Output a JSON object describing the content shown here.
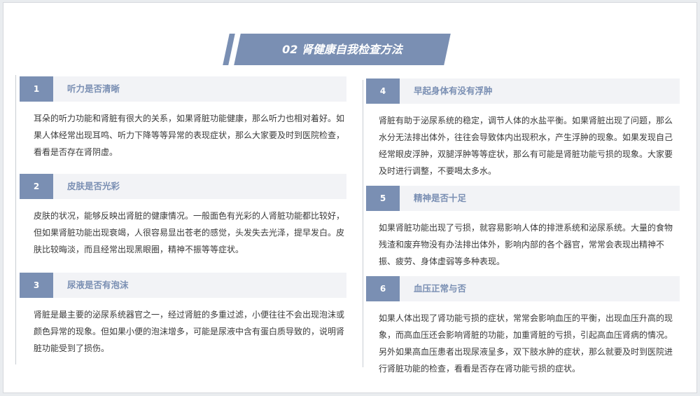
{
  "page": {
    "title": "02 肾健康自我检查方法"
  },
  "colors": {
    "accent": "#7a8fb3",
    "header_bg": "#f2f3f6",
    "body_text": "#3a3a3a"
  },
  "items": [
    {
      "number": "1",
      "title": "听力是否清晰",
      "body": "耳朵的听力功能和肾脏有很大的关系，如果肾脏功能健康，那么听力也相对着好。如果人体经常出现耳鸣、听力下降等等异常的表现症状，那么大家要及时到医院检查，看看是否存在肾阴虚。"
    },
    {
      "number": "2",
      "title": "皮肤是否光彩",
      "body": "皮肤的状况，能够反映出肾脏的健康情况。一般面色有光彩的人肾脏功能都比较好，但如果肾脏功能出现衰竭，人很容易显出苍老的感觉，头发失去光泽，提早发白。皮肤比较晦淡，而且经常出现黑眼圈，精神不振等等症状。"
    },
    {
      "number": "3",
      "title": "尿液是否有泡沫",
      "body": "肾脏是最主要的泌尿系统器官之一，经过肾脏的多重过滤，小便往往不会出现泡沫或颜色异常的现象。但如果小便的泡沫增多，可能是尿液中含有蛋白质导致的，说明肾脏功能受到了损伤。"
    },
    {
      "number": "4",
      "title": "早起身体有没有浮肿",
      "body": "肾脏有助于泌尿系统的稳定，调节人体的水盐平衡。如果肾脏出现了问题，那么水分无法排出体外，往往会导致体内出现积水，产生浮肿的现象。如果发现自己经常眼皮浮肿，双腿浮肿等等症状，那么有可能是肾脏功能亏损的现象。大家要及时进行调整，不要喝太多水。"
    },
    {
      "number": "5",
      "title": "精神是否十足",
      "body": "如果肾脏功能出现了亏损，就容易影响人体的排泄系统和泌尿系统。大量的食物残渣和废弃物没有办法排出体外，影响内部的各个器官，常常会表现出精神不振、疲劳、身体虚弱等多种表现。"
    },
    {
      "number": "6",
      "title": "血压正常与否",
      "body": "如果人体出现了肾功能亏损的症状，常常会影响血压的平衡，出现血压升高的现象，而高血压还会影响肾脏的功能，加重肾脏的亏损，引起高血压肾病的情况。另外如果高血压患者出现尿液呈多，双下肢水肿的症状，那么就要及时到医院进行肾脏功能的检查，看看是否存在肾功能亏损的症状。"
    }
  ]
}
